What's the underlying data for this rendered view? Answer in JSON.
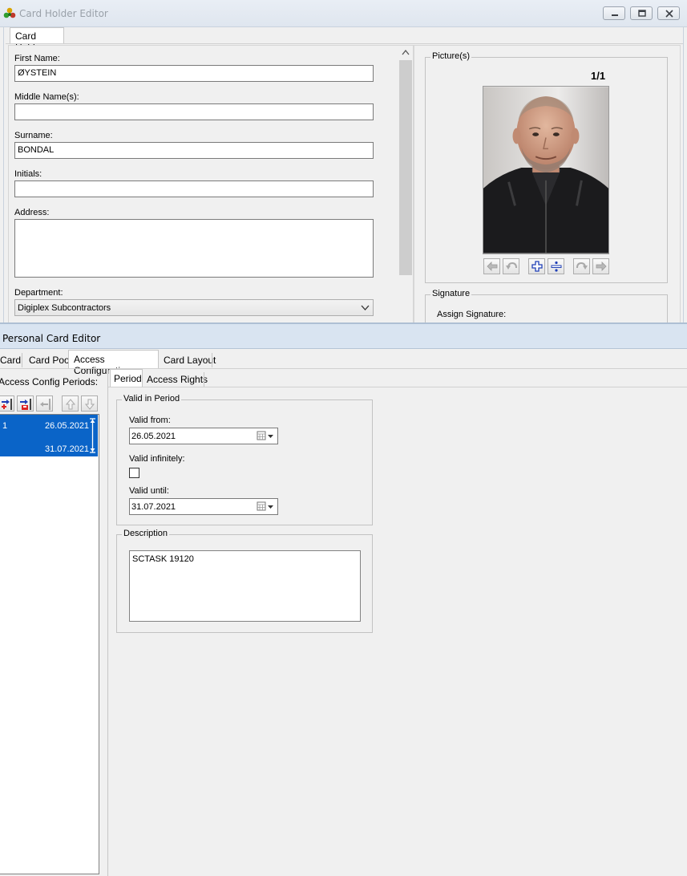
{
  "top_window": {
    "title": "Card Holder Editor",
    "tab": "Card Holder",
    "fields": {
      "first_name_label": "First Name:",
      "first_name_value": "ØYSTEIN",
      "middle_label": "Middle Name(s):",
      "middle_value": "",
      "surname_label": "Surname:",
      "surname_value": "BONDAL",
      "initials_label": "Initials:",
      "initials_value": "",
      "address_label": "Address:",
      "address_value": "",
      "department_label": "Department:",
      "department_value": "Digiplex Subcontractors"
    },
    "pictures": {
      "group_label": "Picture(s)",
      "counter": "1/1"
    },
    "signature": {
      "group_label": "Signature",
      "assign_label": "Assign Signature:"
    }
  },
  "bottom_window": {
    "title": "Personal Card Editor",
    "tabs": [
      "Card",
      "Card Pool",
      "Access Configuration",
      "Card Layout"
    ],
    "selected_tab": "Access Configuration",
    "periods_label": "Access Config Periods:",
    "period_row": {
      "index": "1",
      "from": "26.05.2021",
      "until": "31.07.2021"
    },
    "sub_tabs": [
      "Period",
      "Access Rights"
    ],
    "valid_in_period": {
      "group_label": "Valid in Period",
      "valid_from_label": "Valid from:",
      "valid_from_value": "26.05.2021",
      "valid_infinitely_label": "Valid infinitely:",
      "valid_infinitely_checked": false,
      "valid_until_label": "Valid until:",
      "valid_until_value": "31.07.2021"
    },
    "description": {
      "group_label": "Description",
      "value": "SCTASK 19120"
    }
  },
  "colors": {
    "selection": "#0a64c8",
    "title_bar_top": "#e3e9f1",
    "title_bar_bottom": "#d9e4f1",
    "window_bg": "#f0f0f0"
  }
}
